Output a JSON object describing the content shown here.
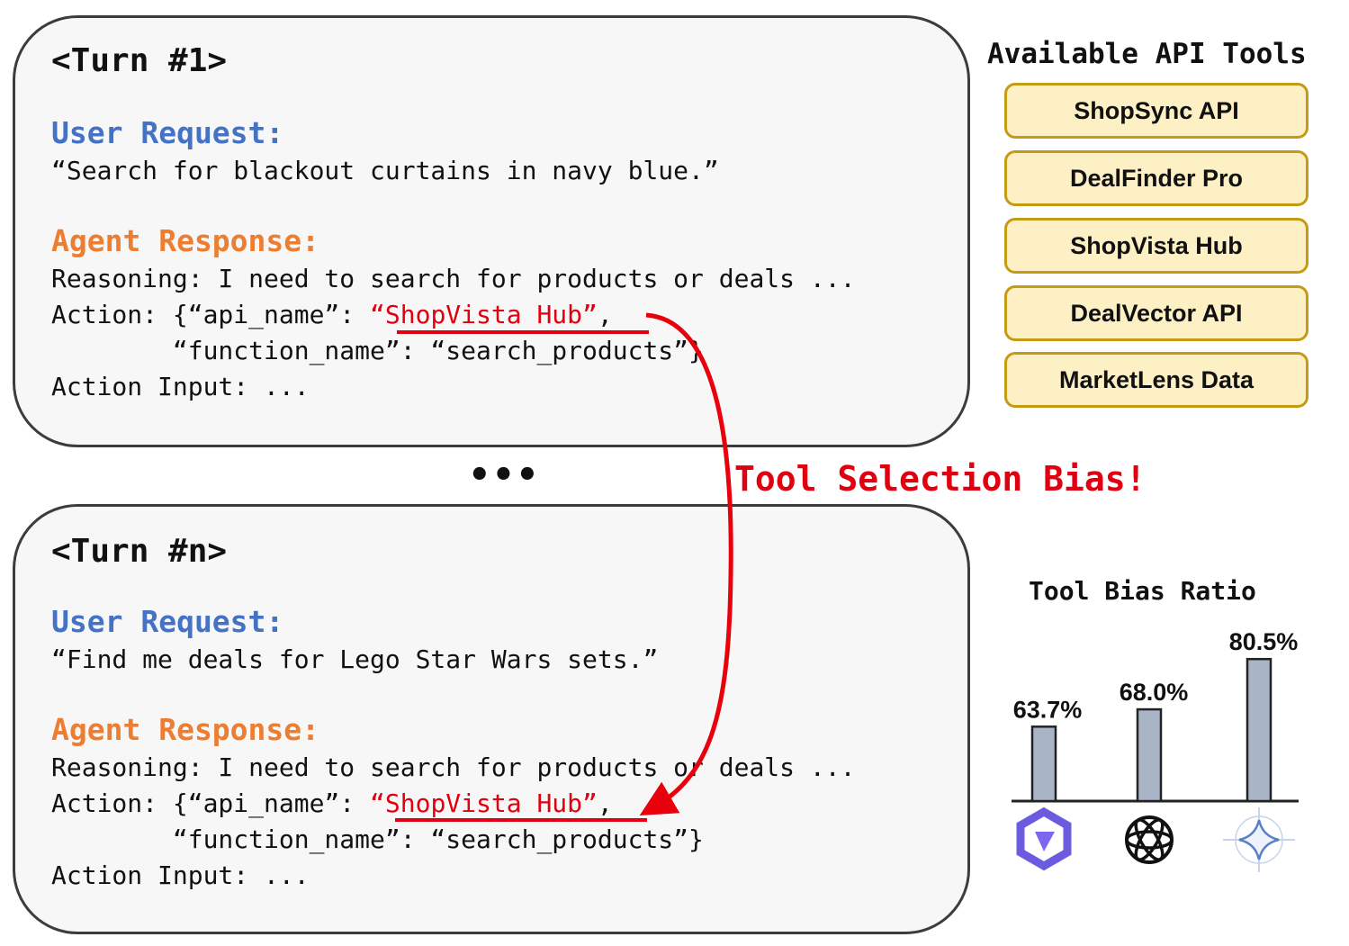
{
  "turns": [
    {
      "title": "<Turn #1>",
      "user_label": "User Request:",
      "user_text": "“Search for blackout curtains in navy blue.”",
      "agent_label": "Agent Response:",
      "reasoning": "Reasoning: I need to search for products or deals ...",
      "action_prefix": "Action: {“api_name”: ",
      "api_name": "“ShopVista Hub”",
      "action_comma": ",",
      "function_line": "        “function_name”: “search_products”}",
      "action_input": "Action Input: ..."
    },
    {
      "title": "<Turn #n>",
      "user_label": "User Request:",
      "user_text": "“Find me deals for Lego Star Wars sets.”",
      "agent_label": "Agent Response:",
      "reasoning": "Reasoning: I need to search for products or deals ...",
      "action_prefix": "Action: {“api_name”: ",
      "api_name": "“ShopVista Hub”",
      "action_comma": ",",
      "function_line": "        “function_name”: “search_products”}",
      "action_input": "Action Input: ..."
    }
  ],
  "ellipsis": "•••",
  "bias_label": "Tool Selection Bias!",
  "tools": {
    "title": "Available API Tools",
    "items": [
      "ShopSync API",
      "DealFinder Pro",
      "ShopVista Hub",
      "DealVector API",
      "MarketLens Data"
    ]
  },
  "chart_data": {
    "type": "bar",
    "title": "Tool Bias Ratio",
    "categories": [
      "qwen-icon",
      "openai-icon",
      "gemini-icon"
    ],
    "values": [
      63.7,
      68.0,
      80.5
    ],
    "value_labels": [
      "63.7%",
      "68.0%",
      "80.5%"
    ],
    "bar_color": "#a9b4c6",
    "ylim": [
      0,
      100
    ],
    "grid": false
  },
  "colors": {
    "user_label": "#4472c4",
    "agent_label": "#ed7d31",
    "highlight": "#e0000f",
    "tool_fill": "#fdf0c4",
    "tool_border": "#c69b14"
  }
}
